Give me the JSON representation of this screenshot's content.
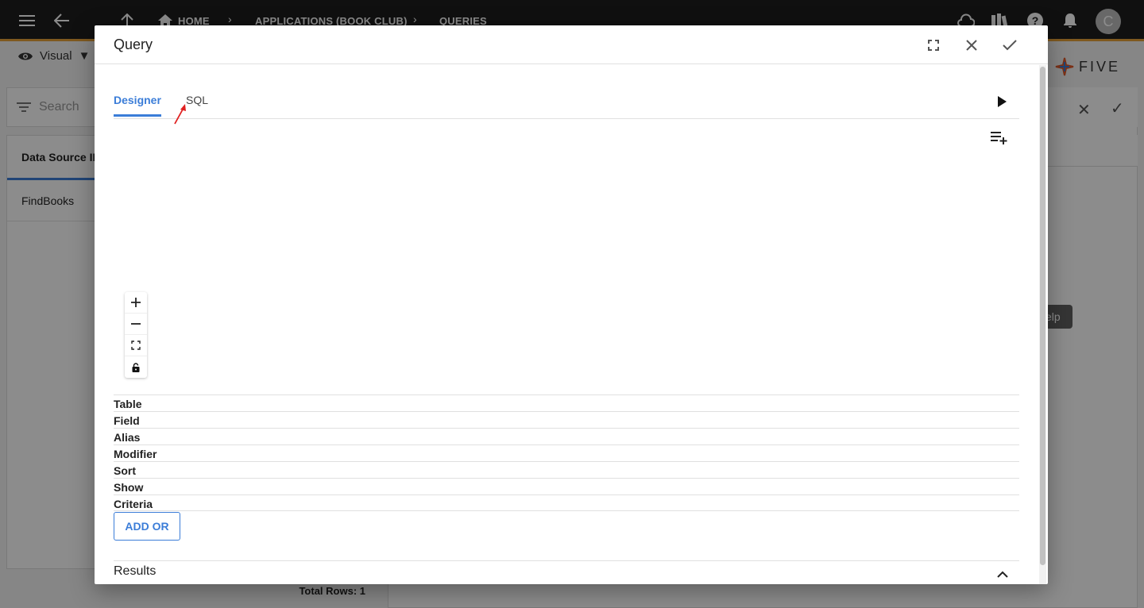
{
  "appbar": {
    "breadcrumbs": [
      "HOME",
      "APPLICATIONS (BOOK CLUB)",
      "QUERIES"
    ],
    "avatar_initial": "C"
  },
  "background": {
    "view_mode": "Visual",
    "search_placeholder": "Search",
    "list_column": "Data Source ID",
    "list_column_visible": "Data Source ID",
    "rows": [
      "FindBooks"
    ],
    "total_rows": "Total Rows: 1",
    "logo_text": "FIVE",
    "help_tooltip": "elp"
  },
  "modal": {
    "title": "Query",
    "tabs": [
      {
        "label": "Designer",
        "active": true
      },
      {
        "label": "SQL",
        "active": false
      }
    ],
    "grid_rows": [
      "Table",
      "Field",
      "Alias",
      "Modifier",
      "Sort",
      "Show",
      "Criteria"
    ],
    "add_or_label": "ADD OR",
    "results_label": "Results"
  },
  "colors": {
    "accent": "#3b7dd8",
    "appbar": "#1e1e1e",
    "appbar_border": "#e8a33a",
    "annotation_arrow": "#e02020"
  }
}
